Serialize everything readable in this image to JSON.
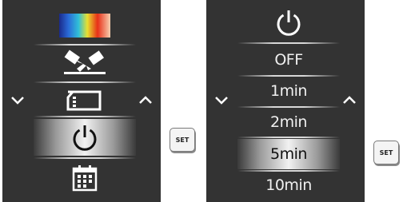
{
  "left_menu": {
    "icons": [
      "color-palette-icon",
      "image-transfer-icon",
      "memory-card-icon",
      "power-icon",
      "calendar-icon"
    ],
    "selected_index": 3
  },
  "right_menu": {
    "header_icon": "power-icon",
    "options": [
      "OFF",
      "1min",
      "2min",
      "5min",
      "10min"
    ],
    "selected_label": "5min"
  },
  "set_label": "SET",
  "colors": {
    "screen_bg": "#333333",
    "selection_center": "#f2f2f2",
    "text": "#f0f0f0"
  }
}
